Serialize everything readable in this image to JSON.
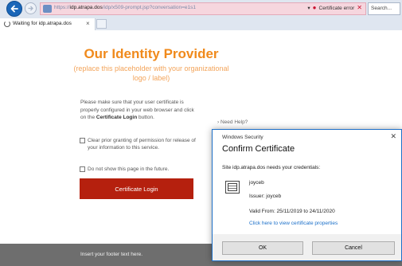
{
  "browser": {
    "back_icon": "arrow-left-icon",
    "address": {
      "url_prefix": "https://",
      "url_host": "idp.atrapa.dos",
      "url_path": "/idp/x509-prompt.jsp?conversation=e1s1",
      "dropdown_glyph": "▾",
      "cert_error_label": "Certificate error",
      "close_glyph": "✕",
      "colors": {
        "background": "#f6d6de",
        "error": "#c8102e"
      }
    },
    "search_placeholder": "Search...",
    "tab": {
      "title": "Waiting for idp.atrapa.dos",
      "close_glyph": "×"
    }
  },
  "page": {
    "title": "Our Identity Provider",
    "subtitle": "(replace this placeholder with your organizational logo / label)",
    "instructions": {
      "text_before": "Please make sure that your user certificate is properly configured in your web browser and click on the ",
      "bold": "Certificate Login",
      "text_after": " button."
    },
    "checkbox_clear": "Clear prior granting of permission for release of your information to this service.",
    "checkbox_dont_show": "Do not show this page in the future.",
    "login_button": "Certificate Login",
    "need_help": "› Need Help?",
    "footer": "Insert your footer text here.",
    "colors": {
      "title": "#f08a1c",
      "button": "#b5200e",
      "footer": "#6e6e6e"
    }
  },
  "dialog": {
    "caption": "Windows Security",
    "close_glyph": "✕",
    "title": "Confirm Certificate",
    "message": "Site idp.atrapa.dos needs your credentials:",
    "cert_name": "joyceb",
    "cert_issuer": "Issuer: joyceb",
    "cert_valid": "Valid From: 25/11/2019 to 24/11/2020",
    "cert_link": "Click here to view certificate properties",
    "ok": "OK",
    "cancel": "Cancel",
    "icon": "certificate-icon"
  }
}
